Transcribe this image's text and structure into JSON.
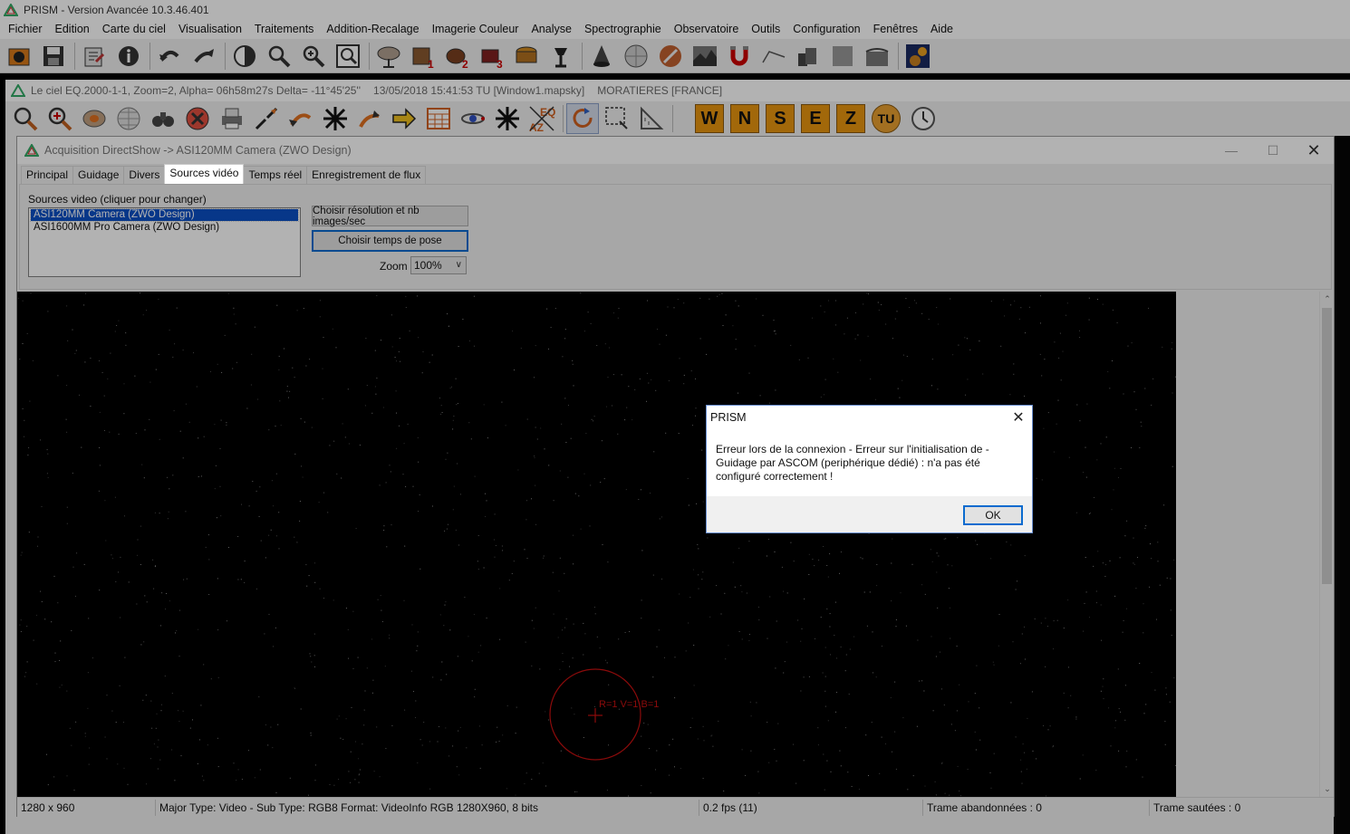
{
  "app": {
    "title": "PRISM - Version Avancée  10.3.46.401",
    "menu": [
      "Fichier",
      "Edition",
      "Carte du ciel",
      "Visualisation",
      "Traitements",
      "Addition-Recalage",
      "Imagerie Couleur",
      "Analyse",
      "Spectrographie",
      "Observatoire",
      "Outils",
      "Configuration",
      "Fenêtres",
      "Aide"
    ],
    "toolbar_icons": [
      "open-icon",
      "save-icon",
      "properties-icon",
      "info-icon",
      "undo-icon",
      "redo-icon",
      "contrast-icon",
      "zoom-out-icon",
      "zoom-in-icon",
      "zoom-fit-icon",
      "telescope-dish-icon",
      "camera-1-icon",
      "camera-2-icon",
      "camera-3-icon",
      "focuser-icon",
      "mount-icon",
      "cone-icon",
      "sphere-icon",
      "pen-icon",
      "noise-image-icon",
      "horseshoe-icon",
      "curve-icon",
      "stack-icon",
      "gray-square-icon",
      "city-icon",
      "weather-icon"
    ]
  },
  "map_window": {
    "title_parts": [
      "Le ciel EQ.2000-1-1, Zoom=2, Alpha= 06h58m27s Delta= -11°45'25''",
      "13/05/2018 15:41:53 TU [Window1.mapsky]",
      "MORATIERES [FRANCE]"
    ],
    "toolbar_icons": [
      "zoom-out-icon",
      "zoom-in-icon",
      "gear-icon",
      "globe-icon",
      "binoculars-icon",
      "stop-icon",
      "print-icon",
      "arrows-in-icon",
      "rotate-icon",
      "star-burst-icon",
      "flip-icon",
      "arrow-right-icon",
      "calendar-icon",
      "orbit-icon",
      "cross-arrows-icon",
      "eq-az-icon",
      "refresh-icon",
      "select-rect-icon",
      "ruler-icon"
    ],
    "direction_buttons": [
      "W",
      "N",
      "S",
      "E",
      "Z"
    ],
    "extra_buttons": [
      "TU"
    ]
  },
  "acquisition": {
    "title": "Acquisition DirectShow -> ASI120MM Camera (ZWO Design)",
    "tabs": [
      "Principal",
      "Guidage",
      "Divers",
      "Sources vidéo",
      "Temps réel",
      "Enregistrement de flux"
    ],
    "active_tab": "Sources vidéo",
    "sources_label": "Sources video (cliquer pour changer)",
    "sources": [
      "ASI120MM Camera (ZWO Design)",
      "ASI1600MM Pro Camera (ZWO Design)"
    ],
    "selected_source": "ASI120MM Camera (ZWO Design)",
    "btn_resolution": "Choisir résolution et nb images/sec",
    "btn_exposure": "Choisir temps de pose",
    "zoom_label": "Zoom",
    "zoom_value": "100%",
    "pixel_readout": "R=1 V=1 B=1",
    "status": {
      "resolution": "1280 x 960",
      "format": "Major Type: Video - Sub Type: RGB8 Format: VideoInfo RGB 1280X960, 8 bits",
      "fps": "0.2 fps (11)",
      "dropped": "Trame abandonnées : 0",
      "skipped": "Trame sautées : 0"
    }
  },
  "error_dialog": {
    "title": "PRISM",
    "message": "Erreur lors de la connexion - Erreur sur l'initialisation de  - Guidage par ASCOM (periphérique dédié) : n'a pas été configuré correctement !",
    "ok_label": "OK"
  },
  "colors": {
    "orange_button": "#e8960f",
    "selection": "#0b4fc4",
    "focus": "#0b6bcf",
    "readout_red": "#c81010"
  }
}
